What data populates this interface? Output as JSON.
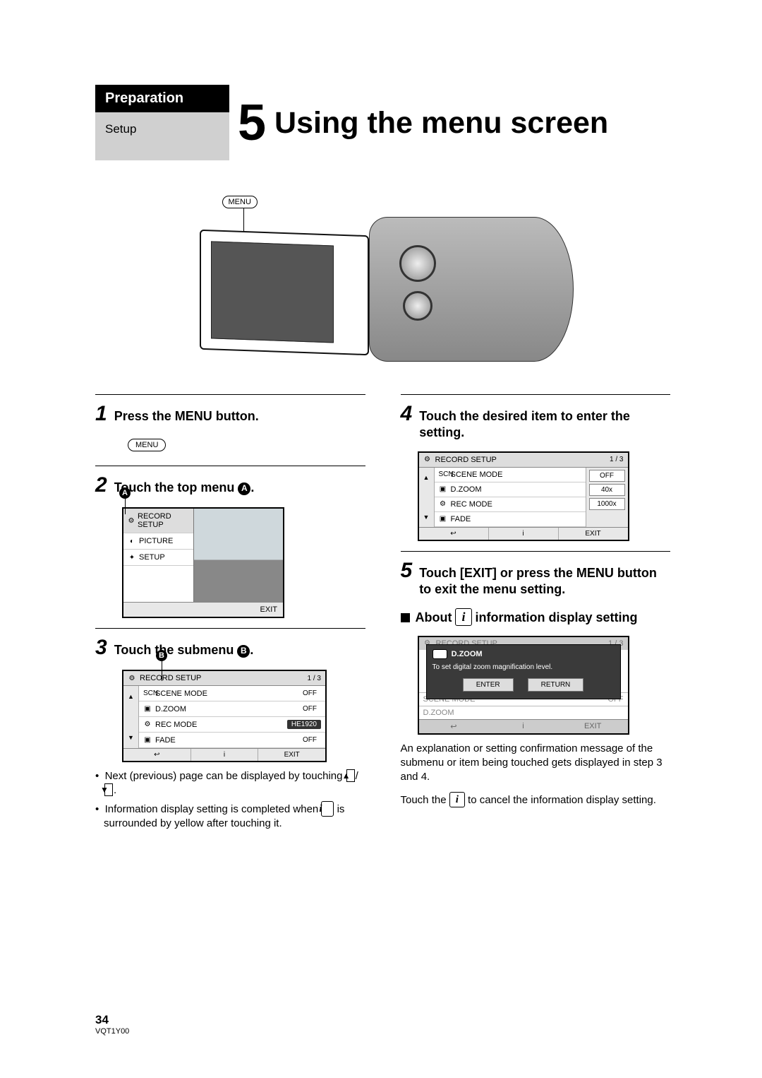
{
  "header": {
    "tab": "Preparation",
    "subsection": "Setup",
    "chapter_number": "5",
    "title": "Using the menu screen"
  },
  "camera_callout": "MENU",
  "steps": {
    "s1": {
      "num": "1",
      "text": "Press the MENU button."
    },
    "s2": {
      "num": "2",
      "text": "Touch the top menu ",
      "label": "A",
      "suffix": "."
    },
    "s3": {
      "num": "3",
      "text": "Touch the submenu ",
      "label": "B",
      "suffix": "."
    },
    "s4": {
      "num": "4",
      "text": "Touch the desired item to enter the setting."
    },
    "s5": {
      "num": "5",
      "text": "Touch [EXIT] or press the MENU button to exit the menu setting."
    }
  },
  "menu_pill": "MENU",
  "ui_a": {
    "items": [
      "RECORD SETUP",
      "PICTURE",
      "SETUP"
    ],
    "exit": "EXIT",
    "label": "A"
  },
  "ui_b": {
    "title": "RECORD SETUP",
    "page": "1 / 3",
    "rows": [
      {
        "icon": "SCN",
        "name": "SCENE MODE",
        "val": "OFF"
      },
      {
        "icon": "▣",
        "name": "D.ZOOM",
        "val": "OFF"
      },
      {
        "icon": "⚙",
        "name": "REC MODE",
        "val": "HE1920",
        "hl": true
      },
      {
        "icon": "▣",
        "name": "FADE",
        "val": "OFF"
      }
    ],
    "left": [
      "▲",
      "",
      "▼"
    ],
    "foot": [
      "↩",
      "i",
      "EXIT"
    ],
    "label": "B"
  },
  "ui_c": {
    "title": "RECORD SETUP",
    "page": "1 / 3",
    "rows": [
      {
        "icon": "SCN",
        "name": "SCENE MODE"
      },
      {
        "icon": "▣",
        "name": "D.ZOOM"
      },
      {
        "icon": "⚙",
        "name": "REC MODE"
      },
      {
        "icon": "▣",
        "name": "FADE"
      }
    ],
    "options": [
      "OFF",
      "40x",
      "1000x"
    ],
    "left": [
      "▲",
      "",
      "▼"
    ],
    "foot": [
      "↩",
      "i",
      "EXIT"
    ]
  },
  "ui_d": {
    "faded_title": "RECORD SETUP",
    "faded_page": "1 / 3",
    "overlay_title": "D.ZOOM",
    "overlay_msg": "To set digital zoom magnification level.",
    "btn_enter": "ENTER",
    "btn_return": "RETURN",
    "bg_rows": [
      {
        "name": "SCENE MODE",
        "val": "OFF"
      },
      {
        "name": "D.ZOOM",
        "val": ""
      }
    ],
    "foot": [
      "↩",
      "i",
      "EXIT"
    ]
  },
  "notes_left": {
    "n1a": "Next (previous) page can be displayed by touching ",
    "n1_up": "▲",
    "n1_sep": "/",
    "n1_dn": "▼",
    "n1b": ".",
    "n2a": "Information display setting is completed when ",
    "n2_info": "i",
    "n2b": " is surrounded by yellow after touching it."
  },
  "about_heading": {
    "pre": "About ",
    "info": "i",
    "post": " information display setting"
  },
  "para_right": {
    "p1": "An explanation or setting confirmation message of the submenu or item being touched gets displayed in step 3 and 4.",
    "p2a": "Touch the ",
    "p2_info": "i",
    "p2b": " to cancel the information display setting."
  },
  "footer": {
    "page": "34",
    "code": "VQT1Y00"
  }
}
